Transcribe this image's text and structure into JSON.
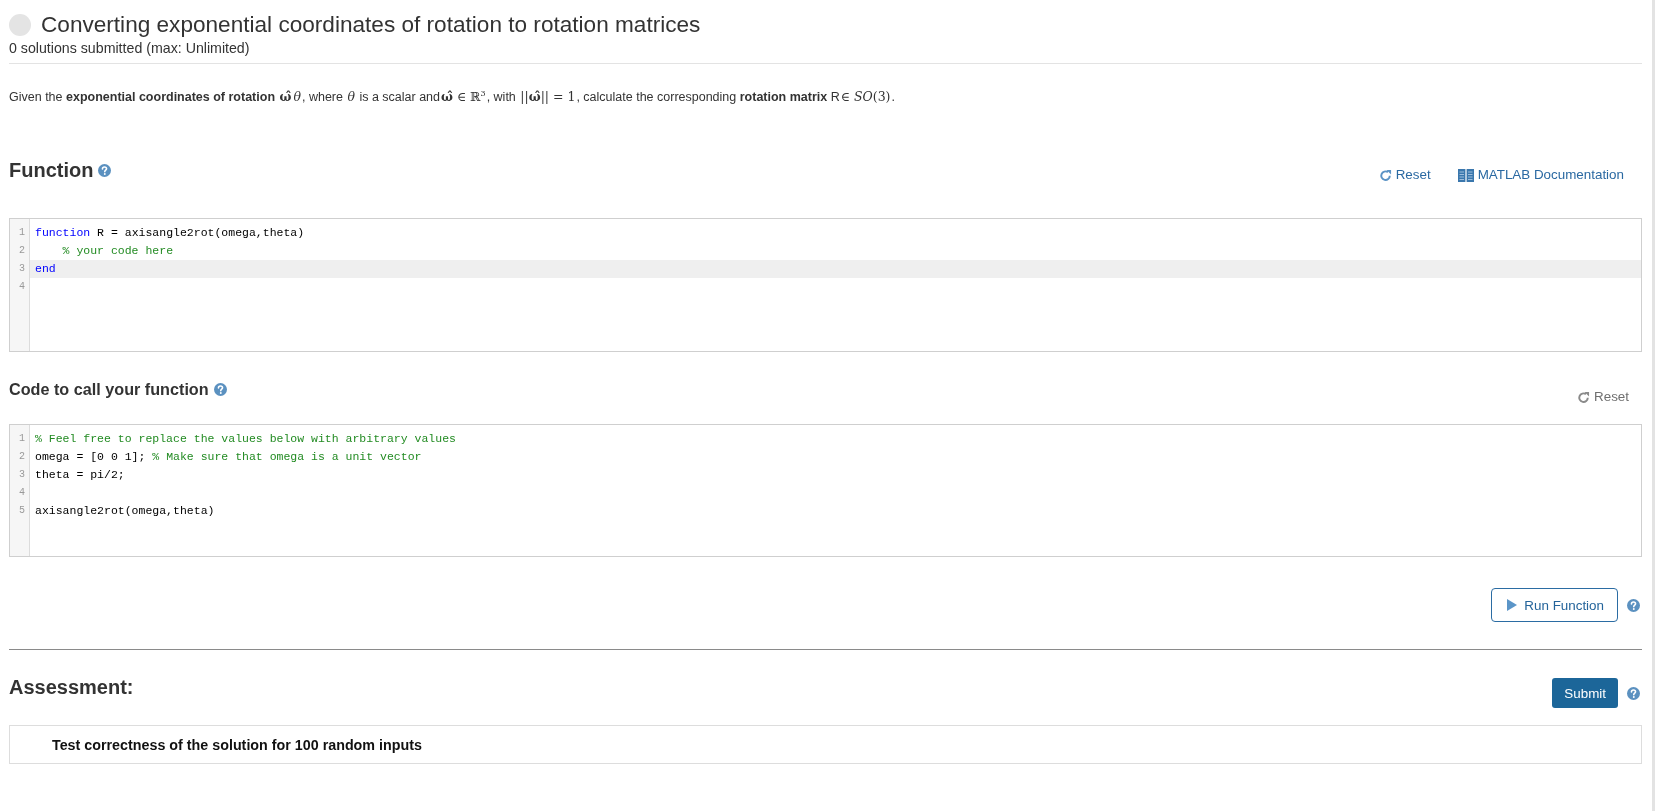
{
  "header": {
    "title": "Converting exponential coordinates of rotation to rotation matrices",
    "submissions": "0 solutions submitted (max: Unlimited)"
  },
  "description": [
    {
      "kind": "text",
      "text": "Given the **exponential coordinates of rotation** "
    },
    {
      "kind": "math",
      "text": "**ω̂**"
    },
    {
      "kind": "math",
      "text": "*θ*"
    },
    {
      "kind": "text",
      "text": ", where "
    },
    {
      "kind": "math",
      "text": "*θ*"
    },
    {
      "kind": "text",
      "text": " is a scalar and"
    },
    {
      "kind": "math",
      "text": "**ω̂** ∈ ℝ$^{3}$"
    },
    {
      "kind": "text",
      "text": ", with "
    },
    {
      "kind": "math",
      "text": "||**ω̂**|| = 1"
    },
    {
      "kind": "text",
      "text": ", calculate the corresponding **rotation matrix** R"
    },
    {
      "kind": "math",
      "text": "∈ *SO*(3)"
    },
    {
      "kind": "text",
      "text": "."
    }
  ],
  "function_section": {
    "heading": "Function",
    "actions": [
      {
        "kind": "reset",
        "label": "Reset",
        "disabled": false
      },
      {
        "kind": "docs",
        "label": "MATLAB Documentation",
        "disabled": false
      }
    ],
    "editor": {
      "lines": [
        {
          "number": "1",
          "highlighted": false,
          "tokens": [
            {
              "kind": "keyword",
              "text": "function"
            },
            {
              "kind": "plain",
              "text": " R = axisangle2rot(omega,theta)"
            }
          ]
        },
        {
          "number": "2",
          "highlighted": false,
          "tokens": [
            {
              "kind": "comment",
              "text": "    % your code here"
            }
          ]
        },
        {
          "number": "3",
          "highlighted": true,
          "tokens": [
            {
              "kind": "keyword",
              "text": "end"
            }
          ]
        },
        {
          "number": "4",
          "highlighted": false
        }
      ]
    }
  },
  "call_section": {
    "heading": "Code to call your function",
    "actions": [
      {
        "kind": "reset",
        "label": "Reset",
        "disabled": true
      }
    ],
    "editor": {
      "lines": [
        {
          "number": "1",
          "highlighted": false,
          "tokens": [
            {
              "kind": "comment",
              "text": "% Feel free to replace the values below with arbitrary values"
            }
          ]
        },
        {
          "number": "2",
          "highlighted": false,
          "tokens": [
            {
              "kind": "plain",
              "text": "omega = [0 0 1]; "
            },
            {
              "kind": "comment",
              "text": "% Make sure that omega is a unit vector"
            }
          ]
        },
        {
          "number": "3",
          "highlighted": false,
          "tokens": [
            {
              "kind": "plain",
              "text": "theta = pi/2;"
            }
          ]
        },
        {
          "number": "4",
          "highlighted": false
        },
        {
          "number": "5",
          "highlighted": false,
          "tokens": [
            {
              "kind": "plain",
              "text": "axisangle2rot(omega,theta)"
            }
          ]
        }
      ]
    }
  },
  "run_button": {
    "label": "Run Function"
  },
  "assessment": {
    "heading": "Assessment:",
    "submit_button": {
      "label": "Submit"
    },
    "tests": [
      {
        "label": "Test correctness of the solution for 100 random inputs"
      }
    ]
  }
}
